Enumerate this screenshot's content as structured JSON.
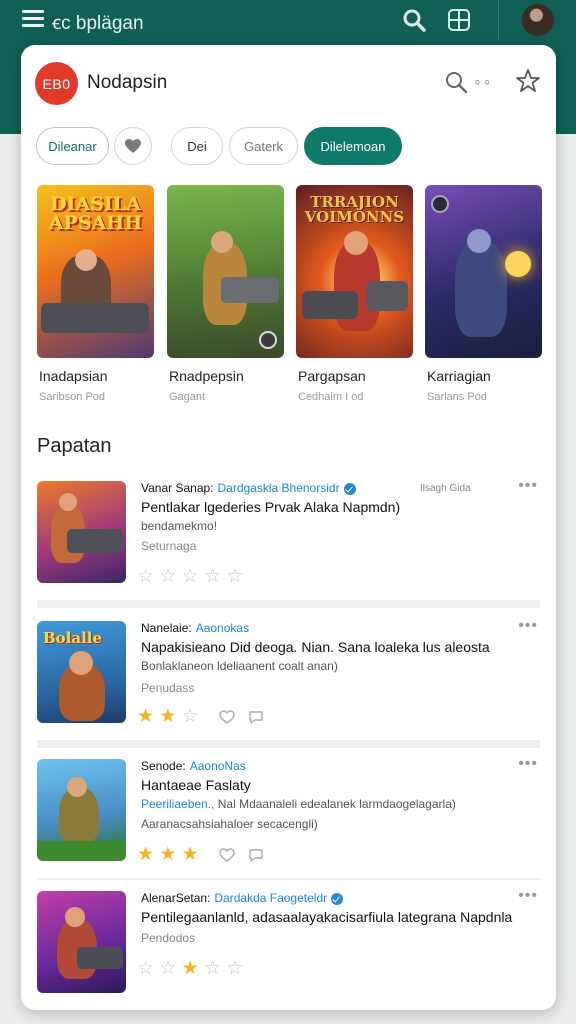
{
  "topbar": {
    "title": "ꞓc bplägan"
  },
  "header": {
    "logo_text": "EB0",
    "app_name": "Nodapsin",
    "more": "∘∘"
  },
  "chips": [
    {
      "label": "Dileanar",
      "selected": false
    },
    {
      "label": "",
      "icon": "heart-icon",
      "selected": false
    },
    {
      "label": "Dei",
      "selected": false
    },
    {
      "label": "Gaterk",
      "selected": false
    },
    {
      "label": "Dilelemoan",
      "selected": true
    }
  ],
  "featured": [
    {
      "name": "Inadapsian",
      "sub": "Saribson Pod",
      "art_text": "DIASILA APSAHH"
    },
    {
      "name": "Rnadpepsin",
      "sub": "Gagant",
      "art_text": ""
    },
    {
      "name": "Pargapsan",
      "sub": "Cedhaim I od",
      "art_text": "TRRAJION VOIMONNS"
    },
    {
      "name": "Karriagian",
      "sub": "Sarlans Pod",
      "art_text": ""
    }
  ],
  "section_title": "Papatan",
  "list": [
    {
      "author": "Vanar Sanap:",
      "link": "Dardgaskla Bhenorsidr",
      "verified": true,
      "tag": "Ilsagh Gida",
      "headline": "Pentlakar lgederies Prvak Alaka Napmdn)",
      "desc": "bendamekmo!",
      "sub": "Seturnaga",
      "stars": [
        false,
        false,
        false,
        false,
        false
      ],
      "thumb_text": ""
    },
    {
      "author": "Nanelaie:",
      "link": "Aaonokas",
      "verified": false,
      "tag": "",
      "headline": "Napakisieano Did deoga. Nian. Sana loaleka lus aleosta",
      "desc": "Bonlaklaneon ldeliaanent coalt anan)",
      "sub": "Penudass",
      "stars": [
        true,
        true,
        false
      ],
      "thumb_text": "Bolalle"
    },
    {
      "author": "Senode:",
      "link": "AaonoNas",
      "verified": false,
      "tag": "",
      "headline": "Hantaeae Faslaty",
      "desc": "Peeriliaeben., Nal Mdaanaleli edealanek larmdaogelagarla)",
      "desc2": "Aaranacsahsiahaloer secacengli)",
      "sub": "",
      "stars": [
        true,
        true,
        true
      ],
      "thumb_text": ""
    },
    {
      "author": "AlenarSetan:",
      "link": "Dardakda Faogeteldr",
      "verified": true,
      "tag": "",
      "headline": "Pentilegaanlanld, adasaalayakacisarfiula lategrana Napdnla",
      "desc": "",
      "sub": "Pendodos",
      "stars": [
        false,
        false,
        true,
        false,
        false
      ],
      "thumb_text": ""
    }
  ],
  "colors": {
    "brand": "#0f5f55",
    "accent": "#0f7a6a",
    "link": "#1a88c9",
    "star": "#f2b324",
    "logo": "#e03a2c"
  }
}
